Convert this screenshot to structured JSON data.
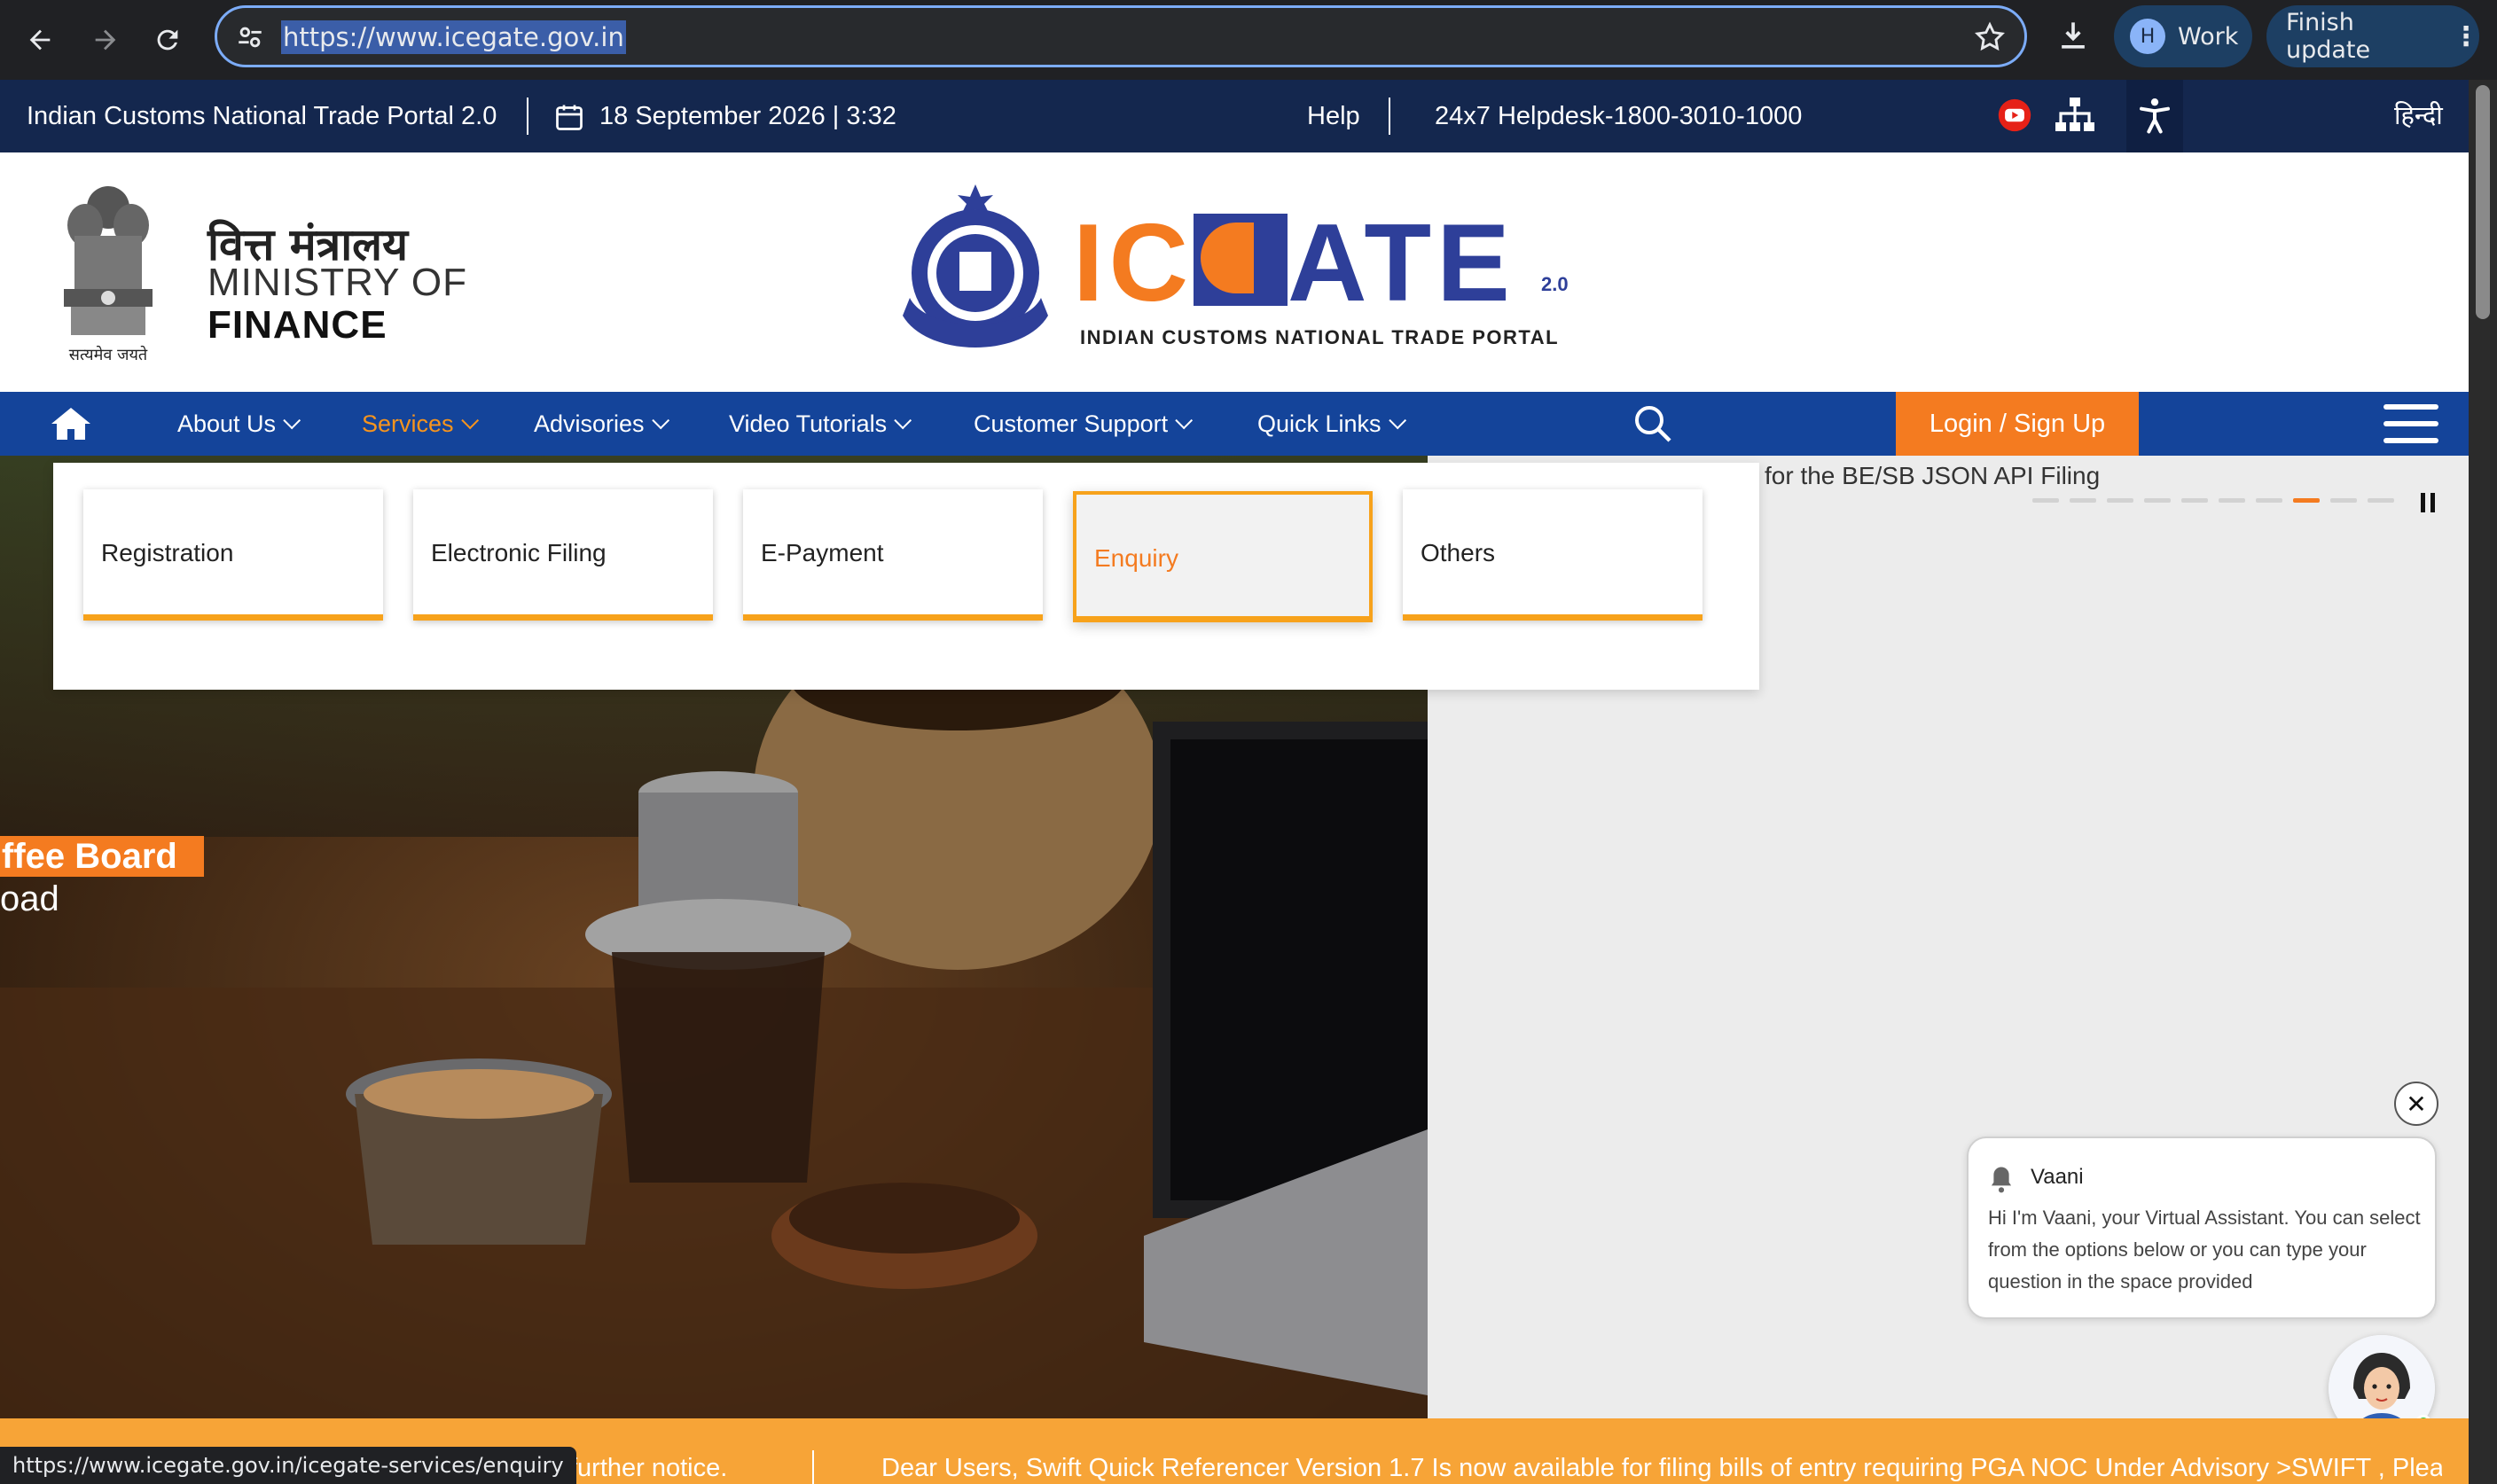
{
  "browser": {
    "url": "https://www.icegate.gov.in",
    "profile_initial": "H",
    "profile_label": "Work",
    "update_label": "Finish update",
    "status_url": "https://www.icegate.gov.in/icegate-services/enquiry"
  },
  "infobar": {
    "portal_name": "Indian Customs National Trade Portal 2.0",
    "date_time": "18 September 2026  |  3:32",
    "help": "Help",
    "helpdesk": "24x7 Helpdesk-1800-3010-1000",
    "language": "हिन्दी"
  },
  "header": {
    "ministry_hi": "वित्त मंत्रालय",
    "ministry_en_line1": "MINISTRY OF",
    "ministry_en_line2": "FINANCE",
    "emblem_motto": "सत्यमेव जयते",
    "logo_orange": "IC",
    "logo_blue": "ATE",
    "logo_version": "2.0",
    "logo_subtitle": "INDIAN CUSTOMS NATIONAL TRADE PORTAL"
  },
  "nav": {
    "items": [
      {
        "label": "About Us"
      },
      {
        "label": "Services"
      },
      {
        "label": "Advisories"
      },
      {
        "label": "Video Tutorials"
      },
      {
        "label": "Customer Support"
      },
      {
        "label": "Quick Links"
      }
    ],
    "active": "Services",
    "login_label": "Login / Sign Up"
  },
  "dropdown": {
    "items": [
      {
        "label": "Registration"
      },
      {
        "label": "Electronic Filing"
      },
      {
        "label": "E-Payment"
      },
      {
        "label": "Enquiry"
      },
      {
        "label": "Others"
      }
    ],
    "highlighted": "Enquiry"
  },
  "hero": {
    "badge_text": "ffee Board",
    "sub_text": "oad",
    "side_text": "for the BE/SB JSON API Filing",
    "slide_count": 10,
    "active_slide": 8
  },
  "chat": {
    "name": "Vaani",
    "message": "Hi I'm Vaani, your Virtual Assistant. You can select from the options below or you can type your question in the space provided",
    "close_symbol": "✕"
  },
  "ticker": {
    "text1": "til further notice.",
    "text2": "Dear Users, Swift Quick Referencer Version 1.7 Is now available for filing bills of entry requiring PGA NOC Under Advisory >SWIFT , Pleas"
  },
  "colors": {
    "navy": "#14274e",
    "nav_blue": "#14449a",
    "orange": "#f47b20",
    "ticker_orange": "#f7a437"
  }
}
